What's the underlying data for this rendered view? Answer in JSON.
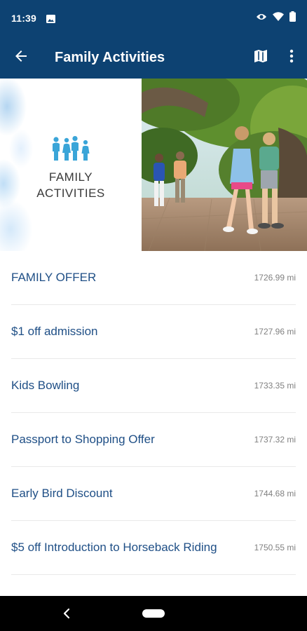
{
  "status_bar": {
    "time": "11:39",
    "icons": [
      "image-icon",
      "eye-icon",
      "wifi-icon",
      "battery-icon"
    ]
  },
  "app_bar": {
    "title": "Family Activities",
    "back_icon": "arrow-left-icon",
    "actions": [
      "map-icon",
      "more-vert-icon"
    ]
  },
  "hero": {
    "label_line1": "FAMILY",
    "label_line2": "ACTIVITIES",
    "icon": "family-icon"
  },
  "offers": [
    {
      "name": "FAMILY OFFER",
      "distance": "1726.99 mi"
    },
    {
      "name": "$1 off admission",
      "distance": "1727.96 mi"
    },
    {
      "name": "Kids Bowling",
      "distance": "1733.35 mi"
    },
    {
      "name": "Passport to Shopping Offer",
      "distance": "1737.32 mi"
    },
    {
      "name": "Early Bird Discount",
      "distance": "1744.68 mi"
    },
    {
      "name": "$5 off Introduction to Horseback Riding",
      "distance": "1750.55 mi"
    }
  ],
  "colors": {
    "primary": "#0d4272",
    "offer_text": "#1f4f86",
    "distance_text": "#808080",
    "icon_accent": "#3aa5d8"
  },
  "nav": {
    "back_icon": "chevron-left-icon",
    "home_icon": "home-pill-icon"
  }
}
